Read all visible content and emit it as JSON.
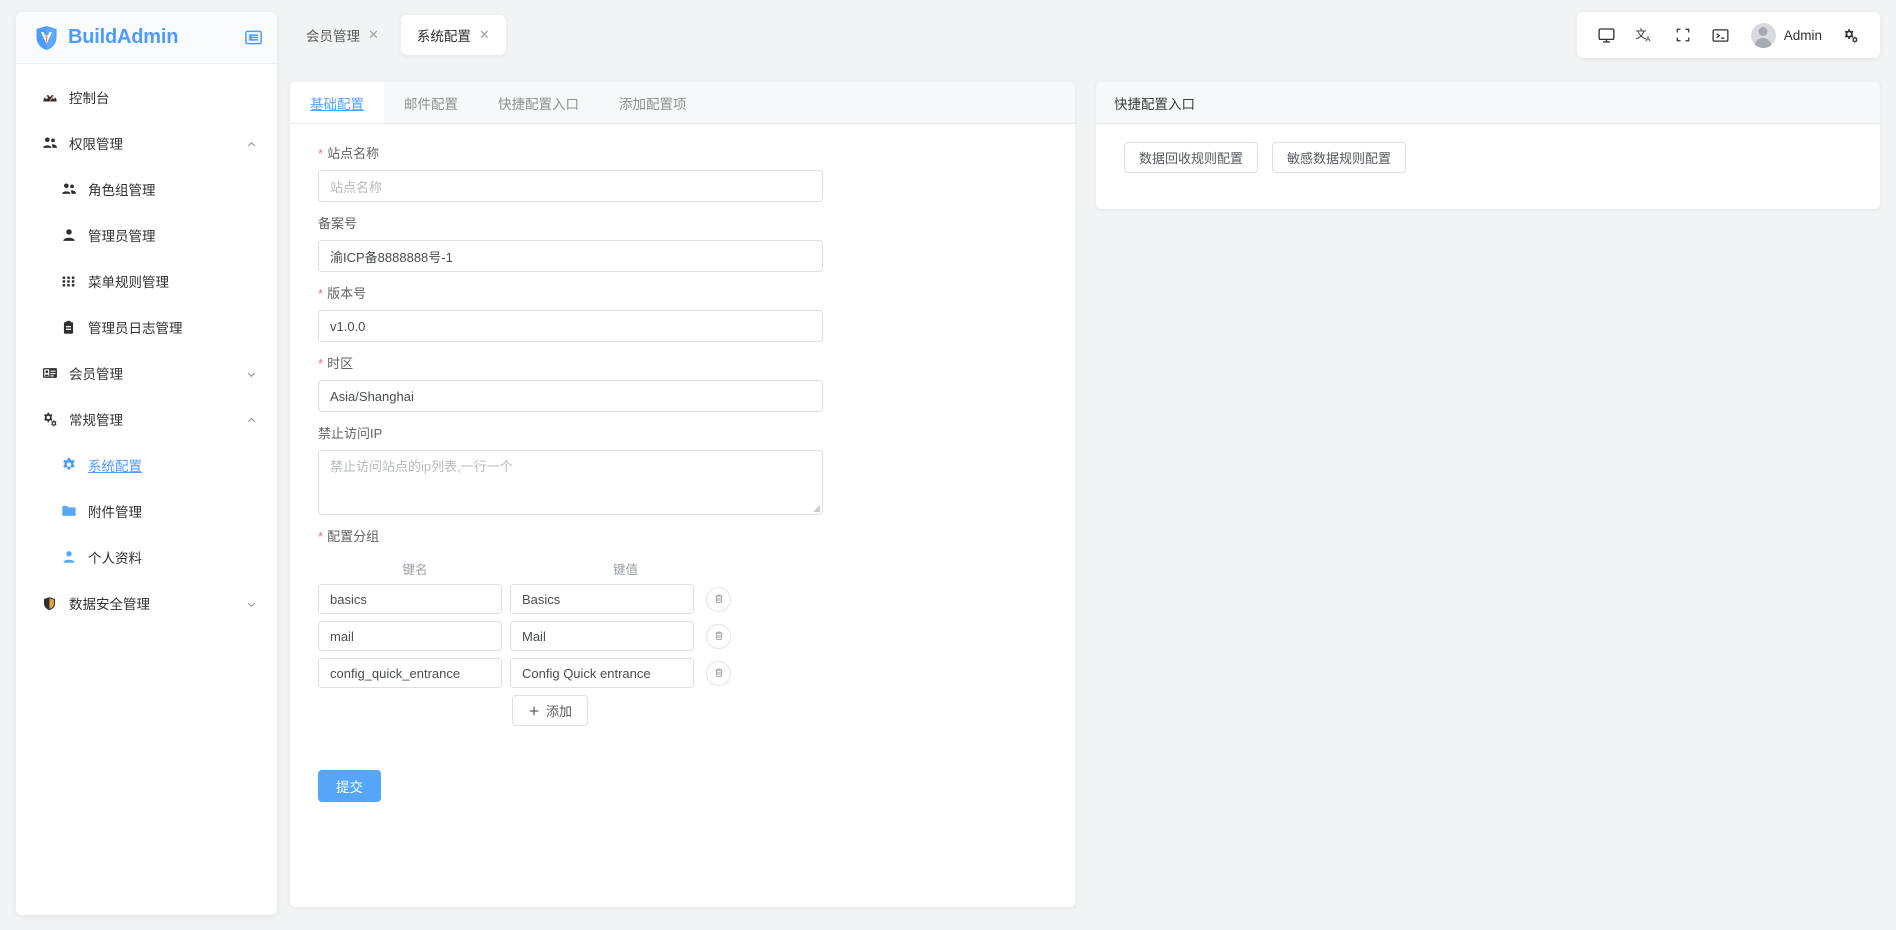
{
  "app": {
    "brand": "BuildAdmin",
    "logo_icon": "shield-v-logo",
    "collapse_icon": "collapse-menu-icon"
  },
  "sidebar": {
    "items": [
      {
        "label": "控制台",
        "icon": "dashboard-icon",
        "level": 0,
        "arrow": "",
        "active": false
      },
      {
        "label": "权限管理",
        "icon": "group-users-icon",
        "level": 0,
        "arrow": "up",
        "active": false
      },
      {
        "label": "角色组管理",
        "icon": "group-users-icon",
        "level": 1,
        "arrow": "",
        "active": false
      },
      {
        "label": "管理员管理",
        "icon": "user-icon",
        "level": 1,
        "arrow": "",
        "active": false
      },
      {
        "label": "菜单规则管理",
        "icon": "grid-icon",
        "level": 1,
        "arrow": "",
        "active": false
      },
      {
        "label": "管理员日志管理",
        "icon": "clipboard-icon",
        "level": 1,
        "arrow": "",
        "active": false
      },
      {
        "label": "会员管理",
        "icon": "id-card-icon",
        "level": 0,
        "arrow": "down",
        "active": false
      },
      {
        "label": "常规管理",
        "icon": "gears-icon",
        "level": 0,
        "arrow": "up",
        "active": false
      },
      {
        "label": "系统配置",
        "icon": "gear-icon",
        "level": 1,
        "arrow": "",
        "active": true
      },
      {
        "label": "附件管理",
        "icon": "folder-icon",
        "level": 1,
        "arrow": "",
        "active": false
      },
      {
        "label": "个人资料",
        "icon": "profile-icon",
        "level": 1,
        "arrow": "",
        "active": false
      },
      {
        "label": "数据安全管理",
        "icon": "shield-icon",
        "level": 0,
        "arrow": "down",
        "active": false
      }
    ]
  },
  "tabbar": {
    "tabs": [
      {
        "label": "会员管理",
        "active": false,
        "close_icon": "close-icon"
      },
      {
        "label": "系统配置",
        "active": true,
        "close_icon": "close-icon"
      }
    ]
  },
  "toolbar": {
    "buttons": [
      {
        "icon": "monitor-icon",
        "name": "screen-mode-button"
      },
      {
        "icon": "language-icon",
        "name": "language-button"
      },
      {
        "icon": "fullscreen-icon",
        "name": "fullscreen-button"
      },
      {
        "icon": "terminal-icon",
        "name": "terminal-button"
      }
    ],
    "user_name": "Admin",
    "settings_icon": "settings-gears-icon"
  },
  "content": {
    "tabs": [
      {
        "label": "基础配置",
        "active": true
      },
      {
        "label": "邮件配置",
        "active": false
      },
      {
        "label": "快捷配置入口",
        "active": false
      },
      {
        "label": "添加配置项",
        "active": false
      }
    ],
    "fields": [
      {
        "label": "站点名称",
        "required": true,
        "type": "text",
        "value": "",
        "placeholder": "站点名称"
      },
      {
        "label": "备案号",
        "required": false,
        "type": "text",
        "value": "渝ICP备8888888号-1",
        "placeholder": ""
      },
      {
        "label": "版本号",
        "required": true,
        "type": "text",
        "value": "v1.0.0",
        "placeholder": ""
      },
      {
        "label": "时区",
        "required": true,
        "type": "text",
        "value": "Asia/Shanghai",
        "placeholder": ""
      },
      {
        "label": "禁止访问IP",
        "required": false,
        "type": "textarea",
        "value": "",
        "placeholder": "禁止访问站点的ip列表,一行一个"
      }
    ],
    "group": {
      "label": "配置分组",
      "required": true,
      "col_key": "键名",
      "col_value": "键值",
      "rows": [
        {
          "key": "basics",
          "value": "Basics",
          "delete_icon": "trash-icon"
        },
        {
          "key": "mail",
          "value": "Mail",
          "delete_icon": "trash-icon"
        },
        {
          "key": "config_quick_entrance",
          "value": "Config Quick entrance",
          "delete_icon": "trash-icon"
        }
      ],
      "add_label": "添加",
      "add_icon": "plus-icon"
    },
    "submit_label": "提交"
  },
  "quick_panel": {
    "title": "快捷配置入口",
    "buttons": [
      {
        "label": "数据回收规则配置"
      },
      {
        "label": "敏感数据规则配置"
      }
    ]
  },
  "colors": {
    "accent": "#4e9bff",
    "primary_button": "#55a5f8",
    "required_star": "#f56c6c",
    "page_bg": "#f2f3f5"
  }
}
